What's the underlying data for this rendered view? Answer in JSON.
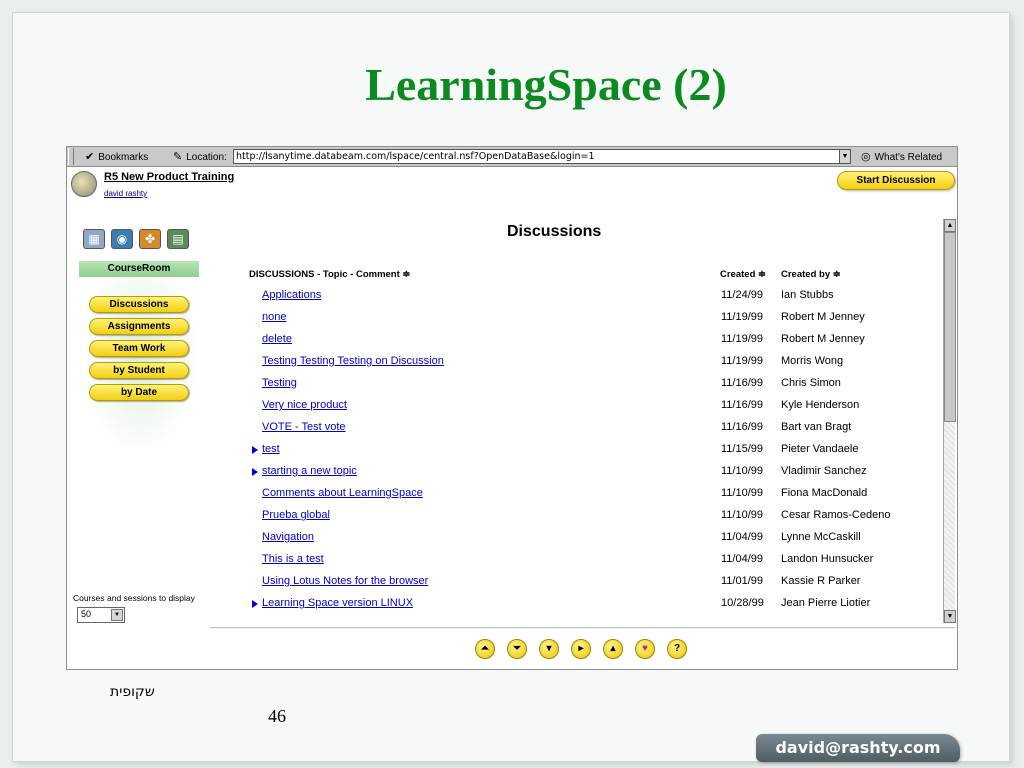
{
  "slide": {
    "title": "LearningSpace (2)",
    "footer_text": "שקופית",
    "number": "46",
    "email": "david@rashty.com"
  },
  "browser": {
    "bookmarks_label": "Bookmarks",
    "location_label": "Location:",
    "url": "http://lsanytime.databeam.com/lspace/central.nsf?OpenDataBase&login=1",
    "whats_related_label": "What's Related"
  },
  "course": {
    "title": "R5 New Product Training",
    "user": "david rashty",
    "start_discussion": "Start Discussion"
  },
  "nav": {
    "courseroom": "CourseRoom",
    "items": [
      {
        "label": "Discussions"
      },
      {
        "label": "Assignments"
      },
      {
        "label": "Team Work"
      },
      {
        "label": "by Student"
      },
      {
        "label": "by Date"
      }
    ],
    "display_label": "Courses and sessions to display",
    "display_value": "50"
  },
  "main": {
    "heading": "Discussions",
    "columns": {
      "topic": "DISCUSSIONS - Topic - Comment ≑",
      "created": "Created ≑",
      "created_by": "Created by ≑"
    },
    "rows": [
      {
        "topic": "Applications",
        "date": "11/24/99",
        "author": "Ian Stubbs",
        "expandable": false
      },
      {
        "topic": "none",
        "date": "11/19/99",
        "author": "Robert M Jenney",
        "expandable": false
      },
      {
        "topic": "delete",
        "date": "11/19/99",
        "author": "Robert M Jenney",
        "expandable": false
      },
      {
        "topic": "Testing Testing Testing on Discussion",
        "date": "11/19/99",
        "author": "Morris Wong",
        "expandable": false
      },
      {
        "topic": "Testing",
        "date": "11/16/99",
        "author": "Chris Simon",
        "expandable": false
      },
      {
        "topic": "Very nice product",
        "date": "11/16/99",
        "author": "Kyle Henderson",
        "expandable": false
      },
      {
        "topic": "VOTE - Test vote",
        "date": "11/16/99",
        "author": "Bart van Bragt",
        "expandable": false
      },
      {
        "topic": "test",
        "date": "11/15/99",
        "author": "Pieter Vandaele",
        "expandable": true
      },
      {
        "topic": "starting a new topic",
        "date": "11/10/99",
        "author": "Vladimir Sanchez",
        "expandable": true
      },
      {
        "topic": "Comments about LearningSpace",
        "date": "11/10/99",
        "author": "Fiona MacDonald",
        "expandable": false
      },
      {
        "topic": "Prueba global",
        "date": "11/10/99",
        "author": "Cesar Ramos-Cedeno",
        "expandable": false
      },
      {
        "topic": "Navigation",
        "date": "11/04/99",
        "author": "Lynne McCaskill",
        "expandable": false
      },
      {
        "topic": "This is a test",
        "date": "11/04/99",
        "author": "Landon Hunsucker",
        "expandable": false
      },
      {
        "topic": "Using Lotus Notes for the browser",
        "date": "11/01/99",
        "author": "Kassie R Parker",
        "expandable": false
      },
      {
        "topic": "Learning Space version LINUX",
        "date": "10/28/99",
        "author": "Jean Pierre Liotier",
        "expandable": true
      }
    ]
  },
  "pager": [
    "collapse-all-icon",
    "expand-all-icon",
    "next-icon",
    "play-icon",
    "up-icon",
    "heart-icon",
    "help-icon"
  ],
  "colors": {
    "title_green": "#0b8a1f",
    "link_blue": "#0000c8",
    "button_yellow": "#f1cf10"
  }
}
